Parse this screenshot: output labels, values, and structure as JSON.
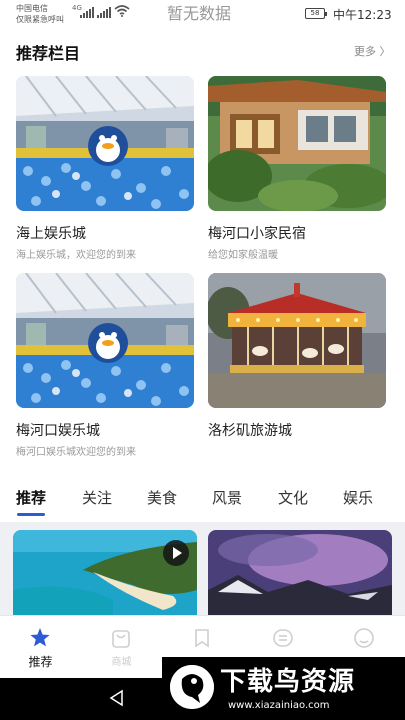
{
  "status_bar": {
    "carrier_line1": "中国电信",
    "carrier_line2": "仅限紧急呼叫",
    "network": "4G",
    "title": "暂无数据",
    "battery": "58",
    "time": "中午12:23"
  },
  "recommend": {
    "title": "推荐栏目",
    "more": "更多 〉",
    "items": [
      {
        "name": "海上娱乐城",
        "desc": "海上娱乐城，欢迎您的到来"
      },
      {
        "name": "梅河口小家民宿",
        "desc": "给您如家般温暖"
      },
      {
        "name": "梅河口娱乐城",
        "desc": "梅河口娱乐城欢迎您的到来"
      },
      {
        "name": "洛杉矶旅游城",
        "desc": ""
      }
    ]
  },
  "tabs": [
    "推荐",
    "关注",
    "美食",
    "风景",
    "文化",
    "娱乐"
  ],
  "bottom_nav": [
    {
      "label": "推荐",
      "icon": "star-icon"
    },
    {
      "label": "商城",
      "icon": "shop-bag-icon"
    },
    {
      "label": "",
      "icon": "bookmark-icon"
    },
    {
      "label": "",
      "icon": "message-icon"
    },
    {
      "label": "",
      "icon": "profile-icon"
    }
  ],
  "watermark": {
    "text": "下载鸟资源",
    "url": "www.xiazainiao.com"
  },
  "colors": {
    "accent": "#2c5bd6",
    "nav_active": "#2c5bd6"
  }
}
